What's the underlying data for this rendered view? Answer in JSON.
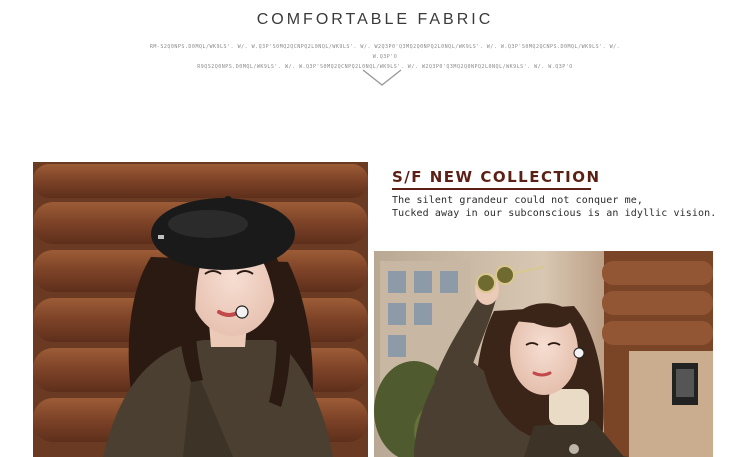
{
  "header": {
    "title": "COMFORTABLE FABRIC",
    "fine_print_line1": "RM-S2Q0NPS.D0MQL/WK9LS'. W/. W.Q3P'S0MQ2QCNPQ2L0NQL/WK9LS'. W/. W2Q3P0'Q3MQ2Q0NPQ2L0NQL/WK9LS'. W/. W.Q3P'S0MQ2QCNPS.D0MQL/WK9LS'. W/. W.Q3P'O",
    "fine_print_line2": "R9QS2Q0NPS.D0MQL/WK9LS'. W/. W.Q3P'S0MQ2QCNPQ2L0NQL/WK9LS'. W/. W2Q3P0'Q3MQ2Q0NPQ2L0NQL/WK9LS'. W/. W.Q3P'O"
  },
  "chevron_icon": "chevron-down-icon",
  "collection": {
    "title": "S/F NEW COLLECTION",
    "line1": "The silent grandeur could not conquer me,",
    "line2": "Tucked away in our subconscious is an idyllic vision."
  },
  "colors": {
    "accent": "#5b1f16",
    "title_text": "#3a3a3a",
    "coat": "#4a3f30",
    "beret": "#1a1a1a",
    "log_wall": "#8a4f2e"
  }
}
